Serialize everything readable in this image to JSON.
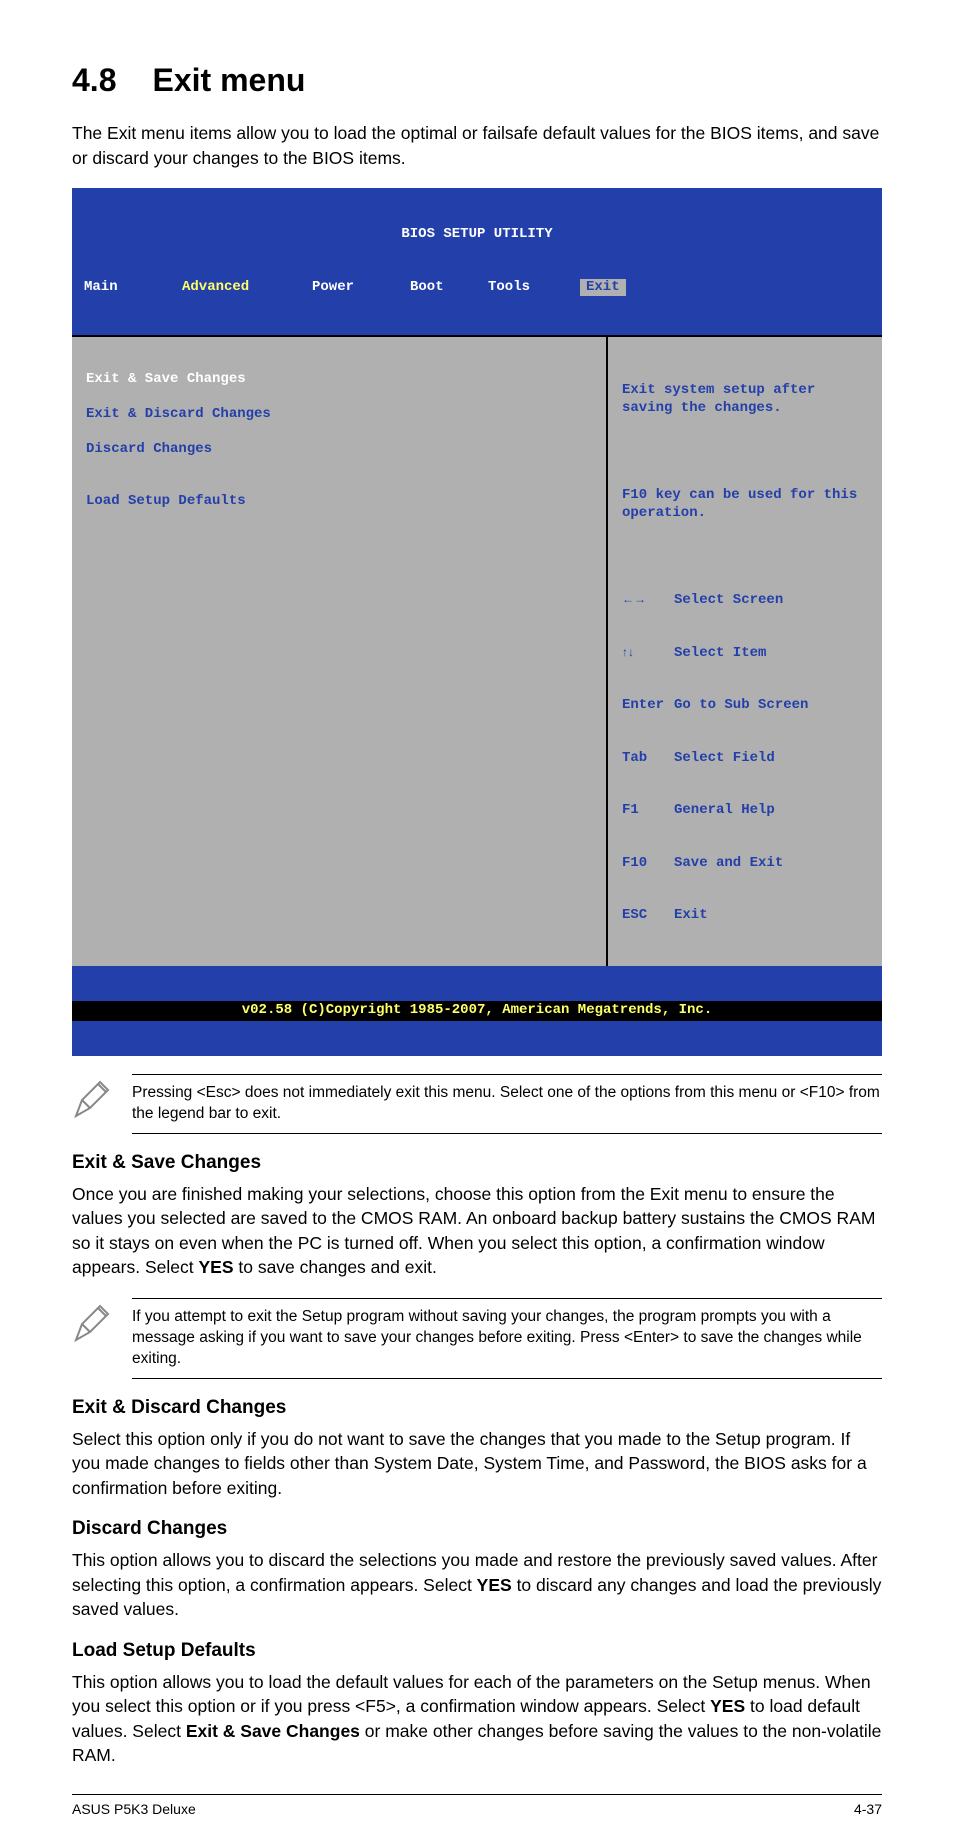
{
  "section": {
    "number": "4.8",
    "title": "Exit menu"
  },
  "intro": "The Exit menu items allow you to load the optimal or failsafe default values for the BIOS items, and save or discard your changes to the BIOS items.",
  "bios": {
    "title": "BIOS SETUP UTILITY",
    "tabs": [
      "Main",
      "Advanced",
      "Power",
      "Boot",
      "Tools",
      "Exit"
    ],
    "left": {
      "items": [
        "Exit & Save Changes",
        "Exit & Discard Changes",
        "Discard Changes",
        "",
        "Load Setup Defaults"
      ]
    },
    "right": {
      "help": [
        "Exit system setup after saving the changes.",
        "",
        "F10 key can be used for this operation."
      ],
      "nav": [
        {
          "key": "←→",
          "label": "Select Screen",
          "icon": "arrows-lr"
        },
        {
          "key": "↑↓",
          "label": "Select Item",
          "icon": "arrows-ud"
        },
        {
          "key": "Enter",
          "label": "Go to Sub Screen"
        },
        {
          "key": "Tab",
          "label": "Select Field"
        },
        {
          "key": "F1",
          "label": "General Help"
        },
        {
          "key": "F10",
          "label": "Save and Exit"
        },
        {
          "key": "ESC",
          "label": "Exit"
        }
      ]
    },
    "footer": "v02.58 (C)Copyright 1985-2007, American Megatrends, Inc."
  },
  "note1": "Pressing <Esc> does not immediately exit this menu. Select one of the options from this menu or <F10> from the legend bar to exit.",
  "exit_save": {
    "heading": "Exit & Save Changes",
    "body_a": "Once you are finished making your selections, choose this option from the Exit menu to ensure the values you selected are saved to the CMOS RAM. An onboard backup battery sustains the CMOS RAM so it stays on even when the PC is turned off. When you select this option, a confirmation window appears. Select ",
    "body_yes": "YES",
    "body_b": " to save changes and exit."
  },
  "note2": "If you attempt to exit the Setup program without saving your changes, the program prompts you with a message asking if you want to save your changes before exiting. Press <Enter> to save the changes while exiting.",
  "exit_discard": {
    "heading": "Exit & Discard Changes",
    "body": "Select this option only if you do not want to save the changes that you  made to the Setup program. If you made changes to fields other than System Date, System Time, and Password, the BIOS asks for a confirmation before exiting."
  },
  "discard": {
    "heading": "Discard Changes",
    "body_a": "This option allows you to discard the selections you made and restore the previously saved values. After selecting this option, a confirmation appears. Select ",
    "body_yes": "YES",
    "body_b": " to discard any changes and load the previously saved values."
  },
  "load_defaults": {
    "heading": "Load Setup Defaults",
    "body_a": "This option allows you to load the default values for each of the parameters on the Setup menus. When you select this option or if you press <F5>, a confirmation window appears. Select ",
    "body_yes": "YES",
    "body_b": " to load default values. Select ",
    "body_esc": "Exit & Save Changes",
    "body_c": " or make other changes before saving the values to the non-volatile RAM."
  },
  "page_footer": {
    "left": "ASUS P5K3 Deluxe",
    "right": "4-37"
  }
}
